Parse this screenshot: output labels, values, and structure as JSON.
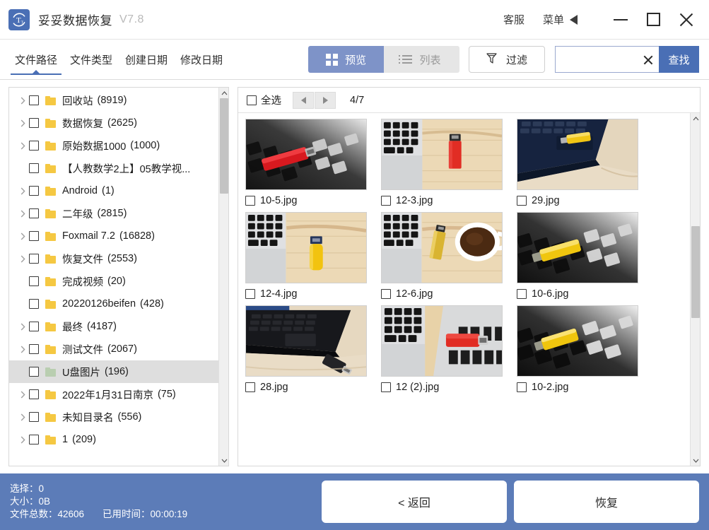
{
  "titlebar": {
    "app_name": "妥妥数据恢复",
    "version": "V7.8",
    "logo_letter": "T",
    "support_label": "客服",
    "menu_label": "菜单",
    "minimize_label": "—",
    "maximize_label": "□",
    "close_label": "✕"
  },
  "tabs": [
    {
      "label": "文件路径",
      "active": true
    },
    {
      "label": "文件类型",
      "active": false
    },
    {
      "label": "创建日期",
      "active": false
    },
    {
      "label": "修改日期",
      "active": false
    }
  ],
  "toolbar": {
    "preview_label": "预览",
    "list_label": "列表",
    "filter_label": "过滤",
    "search_value": "",
    "search_placeholder": "",
    "find_label": "查找"
  },
  "tree": {
    "items": [
      {
        "name": "回收站",
        "count": "(8919)",
        "expandable": true,
        "selected": false,
        "folder": "closed"
      },
      {
        "name": "数据恢复",
        "count": "(2625)",
        "expandable": true,
        "selected": false,
        "folder": "closed"
      },
      {
        "name": "原始数据1000",
        "count": "(1000)",
        "expandable": true,
        "selected": false,
        "folder": "closed"
      },
      {
        "name": "【人教数学2上】05教学视...",
        "count": "",
        "expandable": false,
        "selected": false,
        "folder": "closed"
      },
      {
        "name": "Android",
        "count": "(1)",
        "expandable": true,
        "selected": false,
        "folder": "closed"
      },
      {
        "name": "二年级",
        "count": "(2815)",
        "expandable": true,
        "selected": false,
        "folder": "closed"
      },
      {
        "name": "Foxmail 7.2",
        "count": "(16828)",
        "expandable": true,
        "selected": false,
        "folder": "closed"
      },
      {
        "name": "恢复文件",
        "count": "(2553)",
        "expandable": true,
        "selected": false,
        "folder": "closed"
      },
      {
        "name": "完成视频",
        "count": "(20)",
        "expandable": false,
        "selected": false,
        "folder": "closed"
      },
      {
        "name": "20220126beifen",
        "count": "(428)",
        "expandable": false,
        "selected": false,
        "folder": "closed"
      },
      {
        "name": "最终",
        "count": "(4187)",
        "expandable": true,
        "selected": false,
        "folder": "closed"
      },
      {
        "name": "测试文件",
        "count": "(2067)",
        "expandable": true,
        "selected": false,
        "folder": "closed"
      },
      {
        "name": "U盘图片",
        "count": "(196)",
        "expandable": false,
        "selected": true,
        "folder": "open"
      },
      {
        "name": "2022年1月31日南京",
        "count": "(75)",
        "expandable": true,
        "selected": false,
        "folder": "closed"
      },
      {
        "name": "未知目录名",
        "count": "(556)",
        "expandable": true,
        "selected": false,
        "folder": "closed"
      },
      {
        "name": "1",
        "count": "(209)",
        "expandable": true,
        "selected": false,
        "folder": "closed"
      }
    ]
  },
  "content": {
    "select_all_label": "全选",
    "page_indicator": "4/7",
    "files": [
      {
        "name": "10-5.jpg",
        "art": "red-usb-on-keyboard"
      },
      {
        "name": "12-3.jpg",
        "art": "red-usb-on-wood"
      },
      {
        "name": "29.jpg",
        "art": "yellow-usb-blue-laptop"
      },
      {
        "name": "12-4.jpg",
        "art": "yellow-usb-on-wood"
      },
      {
        "name": "12-6.jpg",
        "art": "gold-usb-coffee"
      },
      {
        "name": "10-6.jpg",
        "art": "yellow-usb-on-keyboard"
      },
      {
        "name": "28.jpg",
        "art": "black-usb-dark-laptop"
      },
      {
        "name": "12 (2).jpg",
        "art": "red-usb-on-poster"
      },
      {
        "name": "10-2.jpg",
        "art": "yellow-usb-keyboard-2"
      }
    ]
  },
  "footer": {
    "selected_label": "选择：",
    "selected_value": "0",
    "size_label": "大小：",
    "size_value": "0B",
    "total_label": "文件总数：",
    "total_value": "42606",
    "elapsed_label": "已用时间：",
    "elapsed_value": "00:00:19",
    "back_label": "< 返回",
    "recover_label": "恢复"
  },
  "colors": {
    "accent": "#4a6fb5",
    "footer_bg": "#5c7cb8",
    "segment_on": "#7e93c8",
    "folder_yellow": "#f5c842",
    "folder_open_green": "#b9ceb0"
  }
}
